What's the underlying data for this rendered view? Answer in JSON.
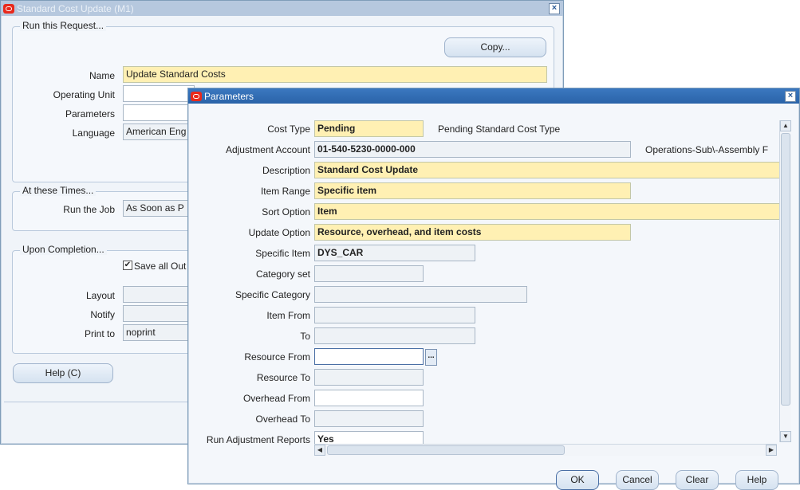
{
  "back_window": {
    "title": "Standard Cost Update (M1)",
    "run_group_label": "Run this Request...",
    "copy_button": "Copy...",
    "labels": {
      "name": "Name",
      "operating_unit": "Operating Unit",
      "parameters": "Parameters",
      "language": "Language"
    },
    "values": {
      "name": "Update Standard Costs",
      "operating_unit": "",
      "parameters": "",
      "language": "American Eng"
    },
    "times_group_label": "At these Times...",
    "run_job_label": "Run the Job",
    "run_job_value": "As Soon as P",
    "completion_group_label": "Upon Completion...",
    "save_output_label": "Save all Out",
    "save_output_checked": "✔",
    "layout_label": "Layout",
    "notify_label": "Notify",
    "print_to_label": "Print to",
    "print_to_value": "noprint",
    "help_button": "Help (C)"
  },
  "parameters_window": {
    "title": "Parameters",
    "rows": [
      {
        "label": "Cost Type",
        "value": "Pending",
        "desc": "Pending Standard Cost Type"
      },
      {
        "label": "Adjustment Account",
        "value": "01-540-5230-0000-000",
        "desc": "Operations-Sub\\-Assembly F"
      },
      {
        "label": "Description",
        "value": "Standard Cost Update"
      },
      {
        "label": "Item Range",
        "value": "Specific item"
      },
      {
        "label": "Sort Option",
        "value": "Item"
      },
      {
        "label": "Update Option",
        "value": "Resource, overhead, and item costs"
      },
      {
        "label": "Specific Item",
        "value": "DYS_CAR"
      },
      {
        "label": "Category set",
        "value": ""
      },
      {
        "label": "Specific Category",
        "value": ""
      },
      {
        "label": "Item From",
        "value": ""
      },
      {
        "label": "To",
        "value": ""
      },
      {
        "label": "Resource From",
        "value": ""
      },
      {
        "label": "Resource To",
        "value": ""
      },
      {
        "label": "Overhead From",
        "value": ""
      },
      {
        "label": "Overhead To",
        "value": ""
      },
      {
        "label": "Run Adjustment Reports",
        "value": "Yes"
      }
    ],
    "lov_button": "...",
    "buttons": {
      "ok": "OK",
      "cancel": "Cancel",
      "clear": "Clear",
      "help": "Help"
    }
  },
  "colors": {
    "required_field": "#fff0b3",
    "active_title": "#2a63a8",
    "inactive_title": "#b6c8de"
  }
}
